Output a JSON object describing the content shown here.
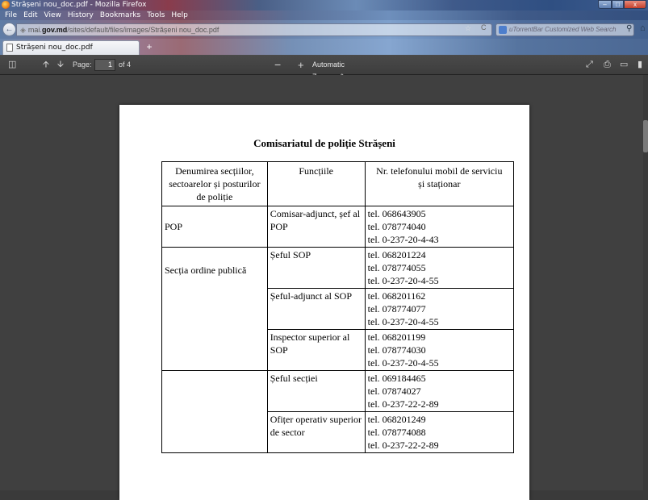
{
  "window": {
    "title": "Strășeni nou_doc.pdf - Mozilla Firefox",
    "min_label": "–",
    "max_label": "□",
    "close_label": "x"
  },
  "menu": [
    "File",
    "Edit",
    "View",
    "History",
    "Bookmarks",
    "Tools",
    "Help"
  ],
  "nav": {
    "url_prefix": "mai.",
    "url_domain": "gov.md",
    "url_path": "/sites/default/files/images/Strășeni nou_doc.pdf",
    "search_placeholder": "uTorrentBar Customized Web Search"
  },
  "tabs": [
    {
      "label": "Strășeni nou_doc.pdf"
    }
  ],
  "pdf_toolbar": {
    "page_label": "Page:",
    "page_value": "1",
    "page_of": "of 4",
    "zoom_label": "Automatic Zoom"
  },
  "document": {
    "title": "Comisariatul de poliție Strășeni",
    "headers": {
      "col1": [
        "Denumirea secțiilor,",
        "sectoarelor și posturilor",
        "de poliție"
      ],
      "col2": [
        "Funcțiile"
      ],
      "col3": [
        "Nr. telefonului mobil de serviciu",
        "și staționar"
      ]
    },
    "rows": [
      {
        "unit": "POP",
        "function": [
          "Comisar-adjunct, șef al",
          "POP"
        ],
        "phones": [
          "tel. 068643905",
          "tel. 078774040",
          "tel. 0-237-20-4-43"
        ]
      },
      {
        "unit": "Secția ordine publică",
        "function": [
          "Șeful SOP"
        ],
        "phones": [
          "tel. 068201224",
          "tel. 078774055",
          "tel. 0-237-20-4-55"
        ]
      },
      {
        "unit": "",
        "function": [
          "Șeful-adjunct al SOP"
        ],
        "phones": [
          "tel. 068201162",
          "tel. 078774077",
          "tel. 0-237-20-4-55"
        ]
      },
      {
        "unit": "",
        "function": [
          "Inspector superior al",
          "SOP"
        ],
        "phones": [
          "tel. 068201199",
          "tel. 078774030",
          "tel. 0-237-20-4-55"
        ]
      },
      {
        "unit": "",
        "function": [
          "Șeful secției"
        ],
        "phones": [
          "tel. 069184465",
          "tel. 07874027",
          "tel. 0-237-22-2-89"
        ]
      },
      {
        "unit": "",
        "function": [
          "Ofițer operativ superior",
          "de sector"
        ],
        "phones": [
          "tel. 068201249",
          "tel. 078774088",
          "tel. 0-237-22-2-89"
        ]
      }
    ]
  }
}
